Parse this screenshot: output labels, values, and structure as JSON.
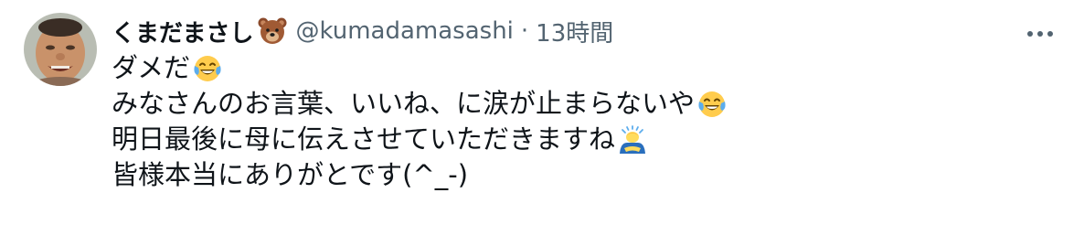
{
  "tweet": {
    "display_name": "くまだまさし",
    "name_emoji": "bear-face",
    "handle": "@kumadamasashi",
    "separator": "·",
    "timestamp": "13時間",
    "more_icon": "ellipsis-icon",
    "lines": [
      {
        "text": "ダメだ",
        "emoji": "tears-of-joy"
      },
      {
        "text": "みなさんのお言葉、いいね、に涙が止まらないや",
        "emoji": "tears-of-joy"
      },
      {
        "text": "明日最後に母に伝えさせていただきますね",
        "emoji": "person-bowing"
      },
      {
        "text": "皆様本当にありがとです(^_-)",
        "emoji": ""
      }
    ]
  },
  "colors": {
    "text": "#0f1419",
    "secondary": "#536471",
    "background": "#ffffff"
  }
}
